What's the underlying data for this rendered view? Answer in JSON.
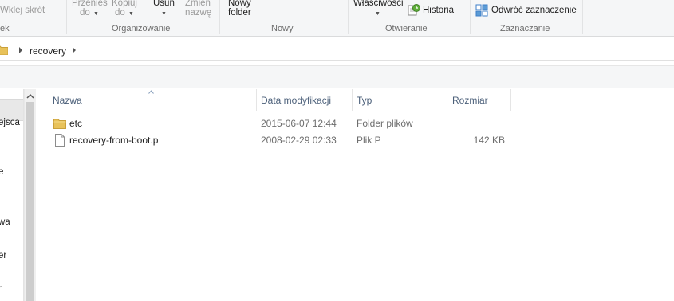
{
  "ribbon": {
    "paste_shortcut_label": "Wklej skrót",
    "move_to_line1": "Przenieś",
    "move_to_line2": "do",
    "copy_to_line1": "Kopiuj",
    "copy_to_line2": "do",
    "delete_label": "Usuń",
    "rename_line1": "Zmień",
    "rename_line2": "nazwę",
    "new_folder_line1": "Nowy",
    "new_folder_line2": "folder",
    "properties_label": "Właściwości",
    "history_label": "Historia",
    "invert_selection_label": "Odwróć zaznaczenie",
    "groups": {
      "clipboard_fragment": "ek",
      "organize": "Organizowanie",
      "new": "Nowy",
      "open": "Otwieranie",
      "select": "Zaznaczanie"
    }
  },
  "address_bar": {
    "breadcrumb": [
      "recovery"
    ]
  },
  "nav_pane": {
    "items": [
      "ejsca",
      "e",
      "wa",
      "er",
      "r"
    ]
  },
  "file_list": {
    "columns": {
      "name": "Nazwa",
      "date": "Data modyfikacji",
      "type": "Typ",
      "size": "Rozmiar"
    },
    "rows": [
      {
        "icon": "folder-icon",
        "name": "etc",
        "date": "2015-06-07 12:44",
        "type": "Folder plików",
        "size": ""
      },
      {
        "icon": "file-icon",
        "name": "recovery-from-boot.p",
        "date": "2008-02-29 02:33",
        "type": "Plik P",
        "size": "142 KB"
      }
    ]
  },
  "colors": {
    "ribbon_bg": "#f5f6f7",
    "header_text": "#4c607a",
    "folder_yellow": "#e8c25a"
  }
}
